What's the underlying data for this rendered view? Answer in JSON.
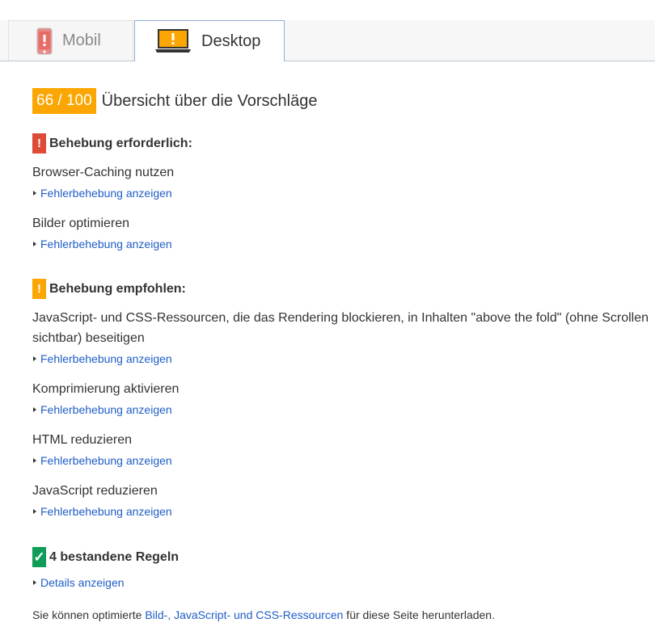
{
  "tabs": {
    "mobile_label": "Mobil",
    "desktop_label": "Desktop"
  },
  "score": {
    "badge": "66 / 100",
    "title": "Übersicht über die Vorschläge",
    "badge_color": "#fba602"
  },
  "required": {
    "mark": "!",
    "heading": "Behebung erforderlich:",
    "rules": [
      {
        "title": "Browser-Caching nutzen",
        "link": "Fehlerbehebung anzeigen"
      },
      {
        "title": "Bilder optimieren",
        "link": "Fehlerbehebung anzeigen"
      }
    ]
  },
  "recommended": {
    "mark": "!",
    "heading": "Behebung empfohlen:",
    "rules": [
      {
        "title": "JavaScript- und CSS-Ressourcen, die das Rendering blockieren, in Inhalten \"above the fold\" (ohne Scrollen sichtbar) beseitigen",
        "link": "Fehlerbehebung anzeigen"
      },
      {
        "title": "Komprimierung aktivieren",
        "link": "Fehlerbehebung anzeigen"
      },
      {
        "title": "HTML reduzieren",
        "link": "Fehlerbehebung anzeigen"
      },
      {
        "title": "JavaScript reduzieren",
        "link": "Fehlerbehebung anzeigen"
      }
    ]
  },
  "passed": {
    "mark": "✓",
    "heading": "4 bestandene Regeln",
    "link": "Details anzeigen"
  },
  "footer": {
    "prefix": "Sie können optimierte ",
    "link": "Bild-, JavaScript- und CSS-Ressourcen",
    "suffix": " für diese Seite herunterladen."
  },
  "colors": {
    "error": "#dd4b39",
    "warning": "#fba602",
    "pass": "#109d59",
    "link": "#1f5ec6"
  },
  "icons": {
    "mobile": "phone-icon",
    "desktop": "laptop-icon"
  }
}
